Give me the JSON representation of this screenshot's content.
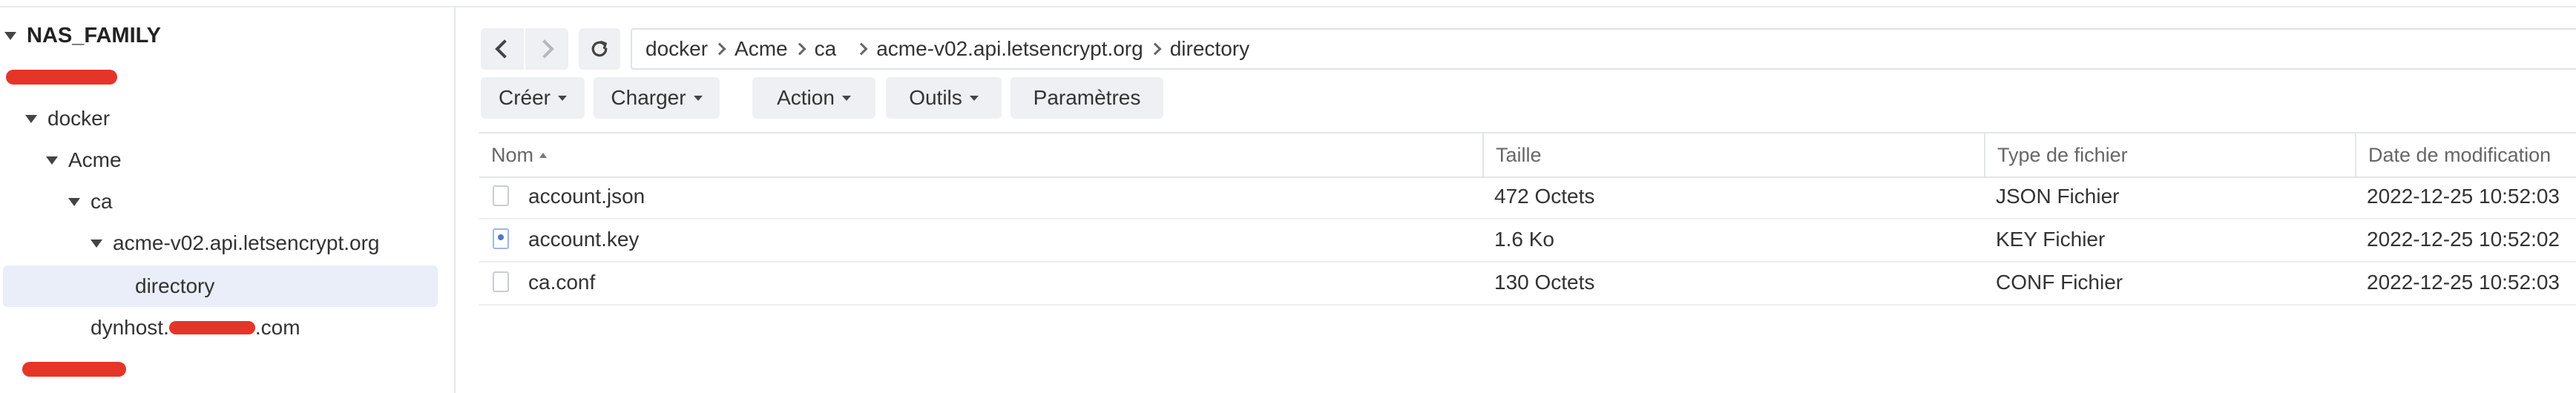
{
  "sidebar": {
    "root_label": "NAS_FAMILY",
    "items": [
      {
        "label": "docker"
      },
      {
        "label": "Acme"
      },
      {
        "label": "ca"
      },
      {
        "label": "acme-v02.api.letsencrypt.org"
      },
      {
        "label": "directory"
      }
    ],
    "dynhost_prefix": "dynhost.",
    "dynhost_suffix": ".com"
  },
  "toolbar": {
    "breadcrumb": [
      "docker",
      "Acme",
      "ca",
      "acme-v02.api.letsencrypt.org",
      "directory"
    ],
    "buttons": {
      "create": "Créer",
      "upload": "Charger",
      "action": "Action",
      "tools": "Outils",
      "settings": "Paramètres"
    }
  },
  "table": {
    "headers": {
      "name": "Nom",
      "size": "Taille",
      "type": "Type de fichier",
      "modified": "Date de modification"
    },
    "rows": [
      {
        "name": "account.json",
        "size": "472 Octets",
        "type": "JSON Fichier",
        "modified": "2022-12-25 10:52:03"
      },
      {
        "name": "account.key",
        "size": "1.6 Ko",
        "type": "KEY Fichier",
        "modified": "2022-12-25 10:52:02"
      },
      {
        "name": "ca.conf",
        "size": "130 Octets",
        "type": "CONF Fichier",
        "modified": "2022-12-25 10:52:03"
      }
    ]
  },
  "colors": {
    "selected_row": "#e9eef9",
    "button_bg": "#eef0f3",
    "redaction": "#e53529"
  }
}
